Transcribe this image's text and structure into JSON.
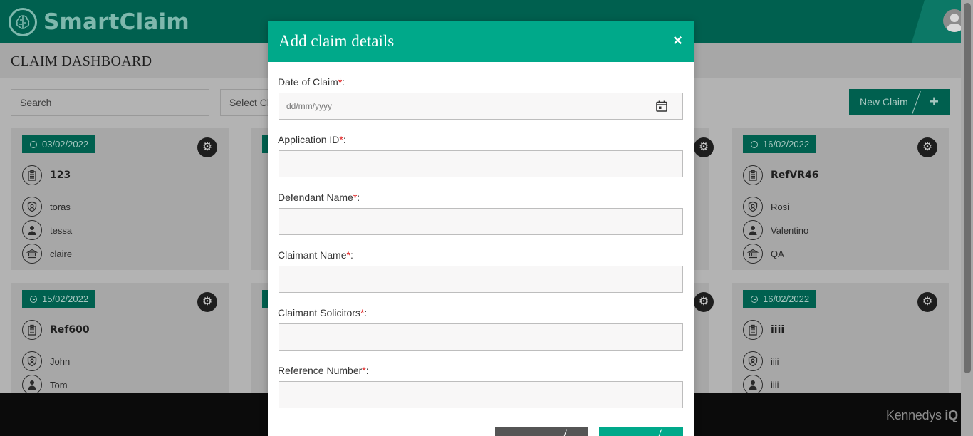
{
  "app": {
    "name": "SmartClaim",
    "page_title": "CLAIM DASHBOARD"
  },
  "toolbar": {
    "search_placeholder": "Search",
    "select_placeholder": "Select Cl",
    "new_claim_label": "New Claim",
    "new_claim_icon": "+"
  },
  "cards": [
    {
      "date": "03/02/2022",
      "ref": "123",
      "defendant": "toras",
      "claimant": "tessa",
      "solicitor": "claire"
    },
    {
      "date": "16/02/2022",
      "ref": "RefVR46",
      "defendant": "Rosi",
      "claimant": "Valentino",
      "solicitor": "QA"
    },
    {
      "date": "15/02/2022",
      "ref": "Ref600",
      "defendant": "John",
      "claimant": "Tom"
    },
    {
      "date": "16/02/2022",
      "ref": "iiii",
      "defendant": "iiii",
      "claimant": "iiii"
    }
  ],
  "footer": {
    "brand": "Kennedys",
    "brand_suffix": "iQ"
  },
  "modal": {
    "title": "Add claim details",
    "close_icon": "×",
    "required_marker": "*",
    "fields": [
      {
        "label": "Date of Claim",
        "placeholder": "dd/mm/yyyy",
        "value": ""
      },
      {
        "label": "Application ID",
        "value": ""
      },
      {
        "label": "Defendant Name",
        "value": ""
      },
      {
        "label": "Claimant Name",
        "value": ""
      },
      {
        "label": "Claimant Solicitors",
        "value": ""
      },
      {
        "label": "Reference Number",
        "value": ""
      }
    ]
  },
  "colors": {
    "brand_dark": "#00604f",
    "modal_accent": "#00a98a",
    "required": "#e11d1d"
  },
  "icons": {
    "logo": "brain-icon",
    "clock": "clock-icon",
    "gear": "gears-icon",
    "reference": "clipboard-icon",
    "defendant": "shield-icon",
    "claimant": "person-icon",
    "solicitor": "bank-icon",
    "calendar": "calendar-icon",
    "close": "close-icon"
  }
}
